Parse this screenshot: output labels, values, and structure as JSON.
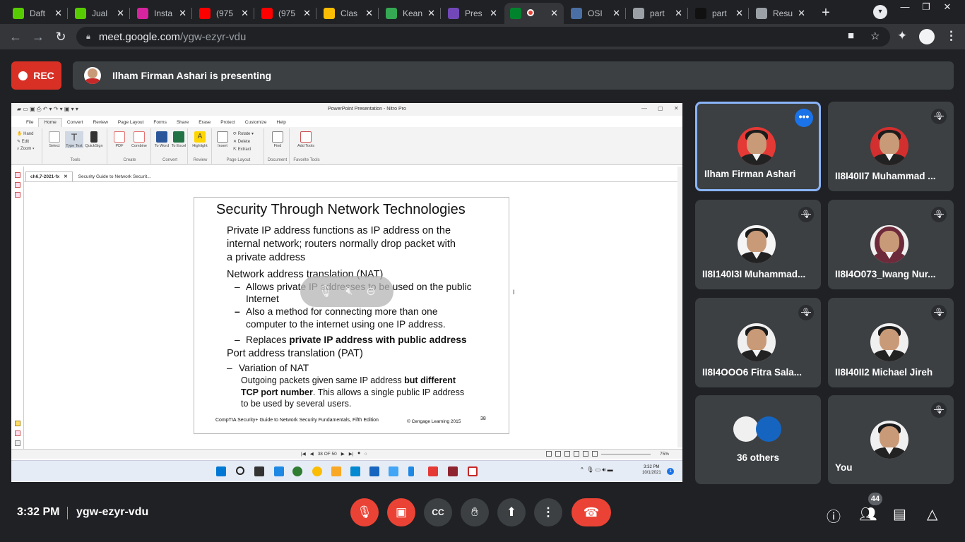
{
  "browser": {
    "tabs": [
      {
        "label": "Daft",
        "icon": "duolingo-owl-icon",
        "color": "#58cc02",
        "active": false
      },
      {
        "label": "Jual",
        "icon": "duolingo-owl-icon",
        "color": "#58cc02",
        "active": false
      },
      {
        "label": "Insta",
        "icon": "instagram-icon",
        "color": "#d6249f",
        "active": false
      },
      {
        "label": "(975",
        "icon": "youtube-icon",
        "color": "#ff0000",
        "active": false
      },
      {
        "label": "(975",
        "icon": "youtube-icon",
        "color": "#ff0000",
        "active": false
      },
      {
        "label": "Clas",
        "icon": "google-classroom-icon",
        "color": "#fbbc04",
        "active": false
      },
      {
        "label": "Kean",
        "icon": "google-classroom-icon",
        "color": "#34a853",
        "active": false
      },
      {
        "label": "Pres",
        "icon": "google-forms-icon",
        "color": "#7248b9",
        "active": false
      },
      {
        "label": "",
        "icon": "google-meet-icon",
        "color": "#00832d",
        "active": true
      },
      {
        "label": "OSI",
        "icon": "osi-icon",
        "color": "#4a6fa5",
        "active": false
      },
      {
        "label": "part",
        "icon": "globe-icon",
        "color": "#9aa0a6",
        "active": false
      },
      {
        "label": "part",
        "icon": "blank-page-icon",
        "color": "#111111",
        "active": false
      },
      {
        "label": "Resu",
        "icon": "chrome-icon",
        "color": "#9aa0a6",
        "active": false
      }
    ],
    "url_host": "meet.google.com",
    "url_path": "/ygw-ezyr-vdu"
  },
  "meet": {
    "rec_label": "REC",
    "presenting_text": "Ilham Firman Ashari is presenting",
    "clock": "3:32 PM",
    "separator": "|",
    "meeting_code": "ygw-ezyr-vdu",
    "participant_count": "44",
    "tiles": [
      {
        "name": "Ilham Firman Ashari",
        "speaking": true,
        "muted": false,
        "bg": "#e53935"
      },
      {
        "name": "II8I40II7 Muhammad ...",
        "speaking": false,
        "muted": true,
        "bg": "#d32f2f"
      },
      {
        "name": "II8I140I3I Muhammad...",
        "speaking": false,
        "muted": true,
        "bg": "#f5f5f5"
      },
      {
        "name": "II8I4O073_Iwang Nur...",
        "speaking": false,
        "muted": true,
        "bg": "#f0f0f0"
      },
      {
        "name": "II8I4OOO6 Fitra Sala...",
        "speaking": false,
        "muted": true,
        "bg": "#f0f0f0"
      },
      {
        "name": "II8I40II2 Michael Jireh",
        "speaking": false,
        "muted": true,
        "bg": "#f0f0f0"
      },
      {
        "name": "36 others",
        "speaking": false,
        "muted": false,
        "bg": "#f0f0f0"
      },
      {
        "name": "You",
        "speaking": false,
        "muted": true,
        "bg": "#f0f0f0"
      }
    ],
    "colors": {
      "red": "#ea4335",
      "blue": "#1a73e8",
      "tile": "#3c4043",
      "speaking_border": "#8ab4f8"
    }
  },
  "nitro": {
    "title": "PowerPoint Presentation - Nitro Pro",
    "menu": [
      "File",
      "Home",
      "Convert",
      "Review",
      "Page Layout",
      "Forms",
      "Share",
      "Erase",
      "Protect",
      "Customize",
      "Help"
    ],
    "ribbon": {
      "hand": "Hand",
      "edit": "Edit",
      "zoom": "Zoom",
      "select": "Select",
      "type_text": "Type Text",
      "quicksign": "QuickSign",
      "pdf": "PDF",
      "combine": "Combine",
      "to_word": "To Word",
      "to_excel": "To Excel",
      "highlight": "Highlight",
      "insert": "Insert",
      "rotate": "Rotate",
      "delete": "Delete",
      "extract": "Extract",
      "find": "Find",
      "add_tools": "Add Tools",
      "groups": [
        "Tools",
        "Create",
        "Convert",
        "Review",
        "Page Layout",
        "Document",
        "Favorite Tools"
      ]
    },
    "doc_tabs": [
      "ch6,7-2021-fx",
      "Security Guide to Network Securit..."
    ],
    "page_indicator": "38 OF 50",
    "zoom": "75%",
    "taskbar_time": "3:32 PM",
    "taskbar_date": "10/1/2021"
  },
  "slide": {
    "title": "Security Through Network  Technologies",
    "p1_l1": "Private IP address functions as IP address on the",
    "p1_l2": "internal network; routers normally drop packet with",
    "p1_l3": "a private  address",
    "p2": "Network address translation (NAT)",
    "dash": "–",
    "p2a_l1": "Allows private IP addresses to be used on the public",
    "p2a_l2": "Internet",
    "p2b_l1": "Also a method for connecting more than one",
    "p2b_l2": "computer to the internet using one IP address.",
    "p2c_plain": "Replaces ",
    "p2c_bold": "private IP address with public address",
    "p3": "Port address translation (PAT)",
    "p3a": "Variation of NAT",
    "p3b_l1_plain": "Outgoing packets given same IP address ",
    "p3b_l1_bold": "but different",
    "p3b_l2_bold": "TCP port number",
    "p3b_l2_plain": ".  This allows a single public IP address",
    "p3b_l3": "to be used by several users.",
    "footer": "CompTIA Security+ Guide to Network Security Fundamentals, Fifth Edition",
    "copyright": "© Cengage Learning  2015",
    "page": "38"
  }
}
